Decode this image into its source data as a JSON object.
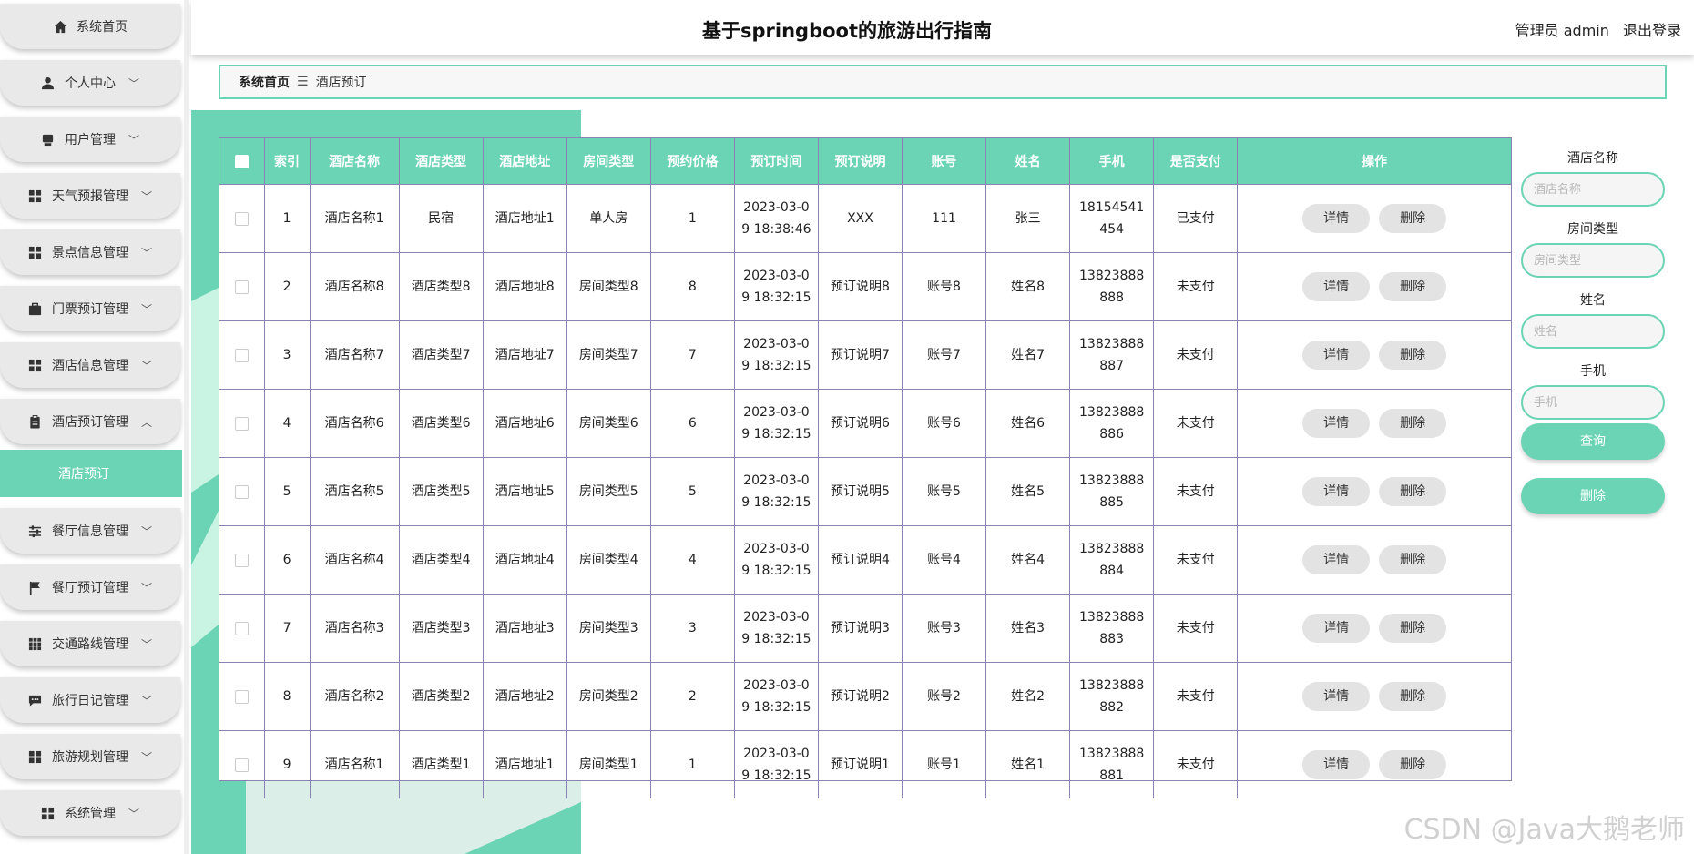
{
  "app": {
    "title": "基于springboot的旅游出行指南",
    "user_label": "管理员 admin",
    "logout_label": "退出登录"
  },
  "sidebar": {
    "items": [
      {
        "label": "系统首页",
        "icon": "home-icon",
        "has_arrow": false
      },
      {
        "label": "个人中心",
        "icon": "user-icon",
        "has_arrow": true
      },
      {
        "label": "用户管理",
        "icon": "printer-icon",
        "has_arrow": true
      },
      {
        "label": "天气预报管理",
        "icon": "grid-icon",
        "has_arrow": true
      },
      {
        "label": "景点信息管理",
        "icon": "grid-icon",
        "has_arrow": true
      },
      {
        "label": "门票预订管理",
        "icon": "briefcase-icon",
        "has_arrow": true
      },
      {
        "label": "酒店信息管理",
        "icon": "grid-icon",
        "has_arrow": true
      },
      {
        "label": "酒店预订管理",
        "icon": "clipboard-icon",
        "has_arrow": true,
        "expanded": true
      },
      {
        "label": "餐厅信息管理",
        "icon": "sliders-icon",
        "has_arrow": true
      },
      {
        "label": "餐厅预订管理",
        "icon": "flag-icon",
        "has_arrow": true
      },
      {
        "label": "交通路线管理",
        "icon": "apps-icon",
        "has_arrow": true
      },
      {
        "label": "旅行日记管理",
        "icon": "chat-icon",
        "has_arrow": true
      },
      {
        "label": "旅游规划管理",
        "icon": "grid-icon",
        "has_arrow": true
      },
      {
        "label": "系统管理",
        "icon": "grid-icon",
        "has_arrow": true
      }
    ],
    "active_sub": "酒店预订"
  },
  "breadcrumb": {
    "home": "系统首页",
    "separator": "☰",
    "current": "酒店预订"
  },
  "table": {
    "headers": [
      "索引",
      "酒店名称",
      "酒店类型",
      "酒店地址",
      "房间类型",
      "预约价格",
      "预订时间",
      "预订说明",
      "账号",
      "姓名",
      "手机",
      "是否支付",
      "操作"
    ],
    "rows": [
      {
        "index": "1",
        "hotel_name": "酒店名称1",
        "hotel_type": "民宿",
        "address": "酒店地址1",
        "room_type": "单人房",
        "price": "1",
        "time": "2023-03-09 18:38:46",
        "note": "XXX",
        "account": "111",
        "name": "张三",
        "phone": "18154541454",
        "paid": "已支付"
      },
      {
        "index": "2",
        "hotel_name": "酒店名称8",
        "hotel_type": "酒店类型8",
        "address": "酒店地址8",
        "room_type": "房间类型8",
        "price": "8",
        "time": "2023-03-09 18:32:15",
        "note": "预订说明8",
        "account": "账号8",
        "name": "姓名8",
        "phone": "13823888888",
        "paid": "未支付"
      },
      {
        "index": "3",
        "hotel_name": "酒店名称7",
        "hotel_type": "酒店类型7",
        "address": "酒店地址7",
        "room_type": "房间类型7",
        "price": "7",
        "time": "2023-03-09 18:32:15",
        "note": "预订说明7",
        "account": "账号7",
        "name": "姓名7",
        "phone": "13823888887",
        "paid": "未支付"
      },
      {
        "index": "4",
        "hotel_name": "酒店名称6",
        "hotel_type": "酒店类型6",
        "address": "酒店地址6",
        "room_type": "房间类型6",
        "price": "6",
        "time": "2023-03-09 18:32:15",
        "note": "预订说明6",
        "account": "账号6",
        "name": "姓名6",
        "phone": "13823888886",
        "paid": "未支付"
      },
      {
        "index": "5",
        "hotel_name": "酒店名称5",
        "hotel_type": "酒店类型5",
        "address": "酒店地址5",
        "room_type": "房间类型5",
        "price": "5",
        "time": "2023-03-09 18:32:15",
        "note": "预订说明5",
        "account": "账号5",
        "name": "姓名5",
        "phone": "13823888885",
        "paid": "未支付"
      },
      {
        "index": "6",
        "hotel_name": "酒店名称4",
        "hotel_type": "酒店类型4",
        "address": "酒店地址4",
        "room_type": "房间类型4",
        "price": "4",
        "time": "2023-03-09 18:32:15",
        "note": "预订说明4",
        "account": "账号4",
        "name": "姓名4",
        "phone": "13823888884",
        "paid": "未支付"
      },
      {
        "index": "7",
        "hotel_name": "酒店名称3",
        "hotel_type": "酒店类型3",
        "address": "酒店地址3",
        "room_type": "房间类型3",
        "price": "3",
        "time": "2023-03-09 18:32:15",
        "note": "预订说明3",
        "account": "账号3",
        "name": "姓名3",
        "phone": "13823888883",
        "paid": "未支付"
      },
      {
        "index": "8",
        "hotel_name": "酒店名称2",
        "hotel_type": "酒店类型2",
        "address": "酒店地址2",
        "room_type": "房间类型2",
        "price": "2",
        "time": "2023-03-09 18:32:15",
        "note": "预订说明2",
        "account": "账号2",
        "name": "姓名2",
        "phone": "13823888882",
        "paid": "未支付"
      },
      {
        "index": "9",
        "hotel_name": "酒店名称1",
        "hotel_type": "酒店类型1",
        "address": "酒店地址1",
        "room_type": "房间类型1",
        "price": "1",
        "time": "2023-03-09 18:32:15",
        "note": "预订说明1",
        "account": "账号1",
        "name": "姓名1",
        "phone": "13823888881",
        "paid": "未支付"
      }
    ],
    "detail_label": "详情",
    "delete_label": "删除"
  },
  "search": {
    "fields": [
      {
        "label": "酒店名称",
        "placeholder": "酒店名称"
      },
      {
        "label": "房间类型",
        "placeholder": "房间类型"
      },
      {
        "label": "姓名",
        "placeholder": "姓名"
      },
      {
        "label": "手机",
        "placeholder": "手机"
      }
    ],
    "query_label": "查询",
    "delete_label": "删除"
  },
  "watermark": "CSDN @Java大鹅老师",
  "colors": {
    "accent": "#6bd4b4",
    "sidebar_item_bg": "#e9e9e9",
    "table_border": "#8a82b0",
    "button_gray": "#e3e3e3"
  }
}
